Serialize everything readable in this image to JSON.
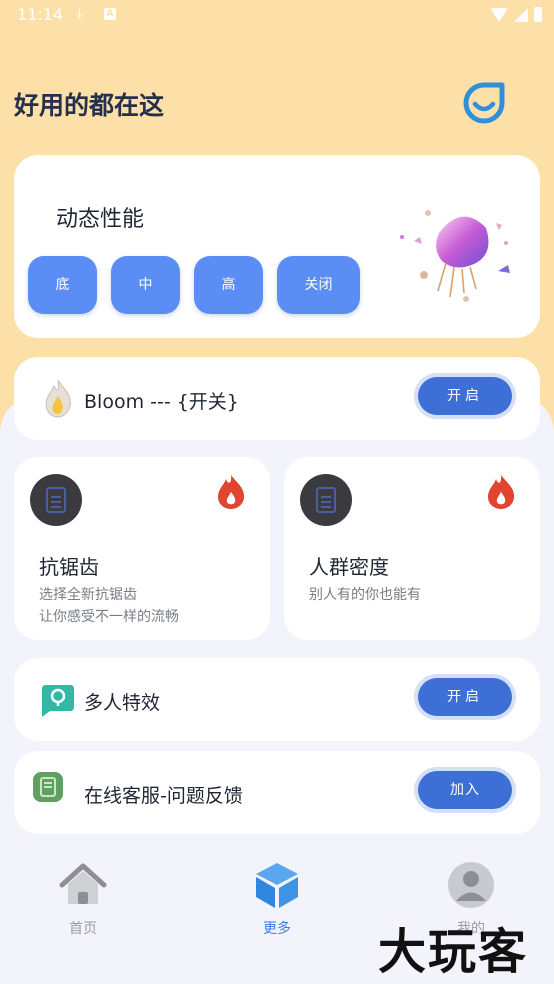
{
  "status_bar": {
    "time": "11:14"
  },
  "header": {
    "title": "好用的都在这"
  },
  "performance": {
    "title": "动态性能",
    "options": [
      "底",
      "中",
      "高",
      "关闭"
    ]
  },
  "bloom": {
    "label": "Bloom --- {开关}",
    "button": "开启"
  },
  "features": [
    {
      "title": "抗锯齿",
      "desc_line1": "选择全新抗锯齿",
      "desc_line2": "让你感受不一样的流畅"
    },
    {
      "title": "人群密度",
      "desc_line1": "别人有的你也能有",
      "desc_line2": ""
    }
  ],
  "multi_effect": {
    "label": "多人特效",
    "button": "开启"
  },
  "support": {
    "label": "在线客服-问题反馈",
    "button": "加入"
  },
  "nav": {
    "items": [
      {
        "label": "首页",
        "icon": "home-icon"
      },
      {
        "label": "更多",
        "icon": "cube-icon"
      },
      {
        "label": "我的",
        "icon": "avatar-icon"
      }
    ],
    "active_color": "#3a7de0",
    "inactive_color": "#9a9ca3"
  },
  "watermark": "大玩客",
  "colors": {
    "accent": "#5b8ef5",
    "header_bg": "#fddfa8",
    "button": "#3d6fd6",
    "fire": "#e2452f"
  }
}
